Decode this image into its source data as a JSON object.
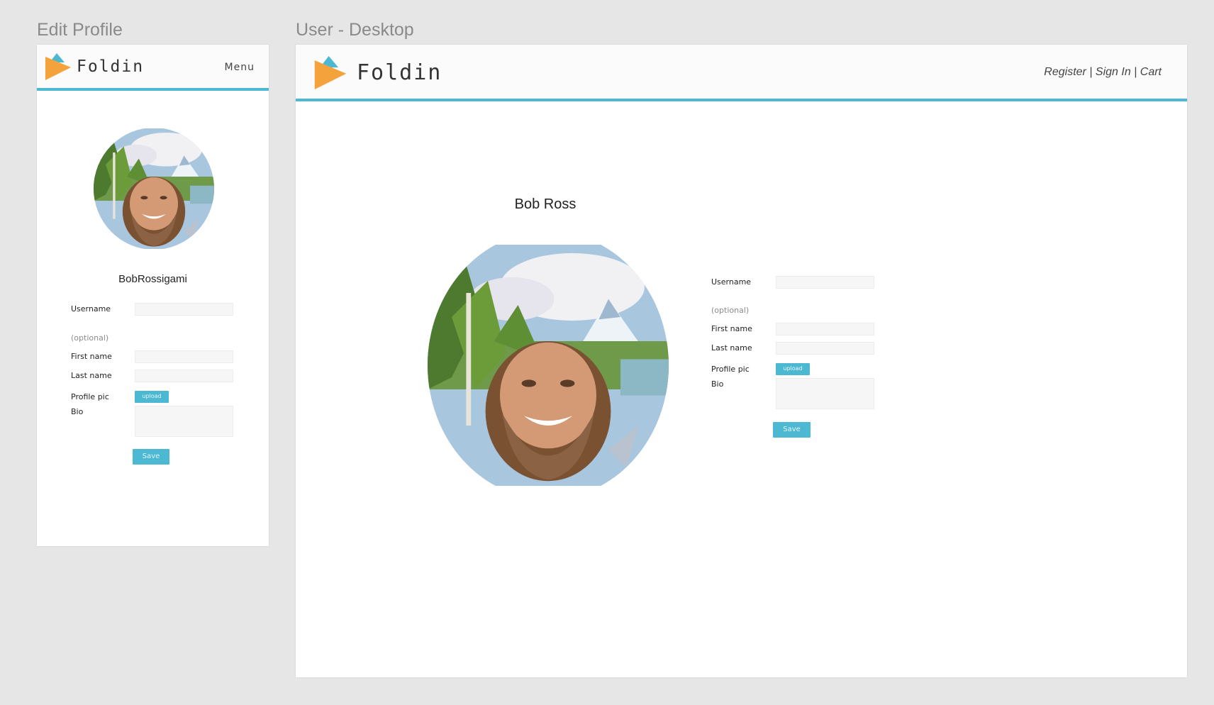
{
  "frames": {
    "mobile_title": "Edit Profile",
    "desktop_title": "User - Desktop"
  },
  "brand": {
    "name": "Foldin",
    "accent_color": "#4db8d1",
    "logo_orange": "#f4a23c",
    "logo_blue": "#4db8d1"
  },
  "mobile": {
    "menu_label": "Menu",
    "display_name": "BobRossigami",
    "form": {
      "username_label": "Username",
      "optional_label": "(optional)",
      "first_name_label": "First name",
      "last_name_label": "Last name",
      "profile_pic_label": "Profile pic",
      "upload_label": "upload",
      "bio_label": "Bio",
      "save_label": "Save"
    }
  },
  "desktop": {
    "nav": {
      "register": "Register",
      "sep1": " | ",
      "sign_in": "Sign In",
      "sep2": " | ",
      "cart": "Cart"
    },
    "display_name": "Bob Ross",
    "form": {
      "username_label": "Username",
      "optional_label": "(optional)",
      "first_name_label": "First name",
      "last_name_label": "Last name",
      "profile_pic_label": "Profile pic",
      "upload_label": "upload",
      "bio_label": "Bio",
      "save_label": "Save"
    }
  }
}
